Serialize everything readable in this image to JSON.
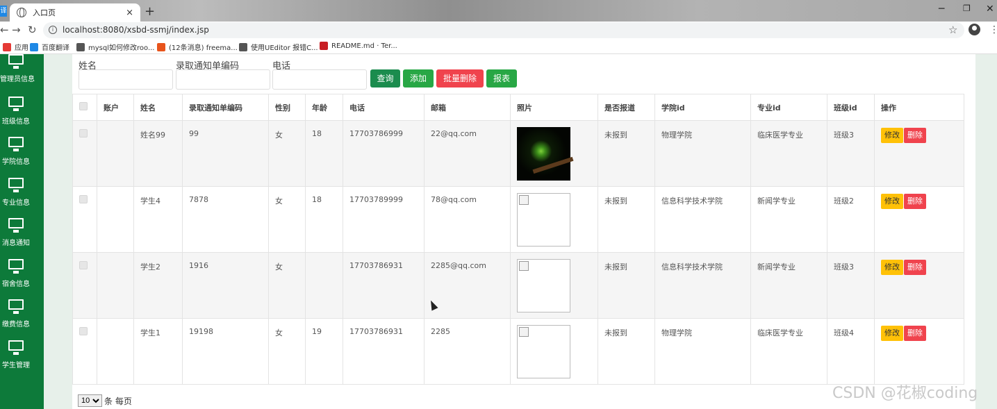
{
  "browser": {
    "tab_title": "入口页",
    "tab_close": "×",
    "new_tab": "+",
    "url": "localhost:8080/xsbd-ssmj/index.jsp",
    "bookmarks": [
      {
        "label": "应用",
        "icon": "apps-icon",
        "color": "#e53935"
      },
      {
        "label": "百度翻译",
        "icon": "baidu-translate-icon",
        "color": "#1e88e5"
      },
      {
        "label": "mysql如何修改roo...",
        "icon": "page-icon",
        "color": "#555555"
      },
      {
        "label": "(12条消息) freema...",
        "icon": "csdn-icon",
        "color": "#e8541c"
      },
      {
        "label": "使用UEditor 报错C...",
        "icon": "page-icon",
        "color": "#555555"
      },
      {
        "label": "README.md · Ter...",
        "icon": "gitee-icon",
        "color": "#c71d23"
      }
    ]
  },
  "sidebar": {
    "items": [
      {
        "label": "管理员信息"
      },
      {
        "label": "班级信息"
      },
      {
        "label": "学院信息"
      },
      {
        "label": "专业信息"
      },
      {
        "label": "消息通知"
      },
      {
        "label": "宿舍信息"
      },
      {
        "label": "缴费信息"
      },
      {
        "label": "学生管理"
      }
    ]
  },
  "filters": {
    "name_label": "姓名",
    "code_label": "录取通知单编码",
    "phone_label": "电话",
    "name_value": "",
    "code_value": "",
    "phone_value": ""
  },
  "buttons": {
    "search": "查询",
    "add": "添加",
    "batch_delete": "批量删除",
    "report": "报表"
  },
  "colors": {
    "sidebar": "#0d7a3a",
    "search_btn": "#1b8c4e",
    "add_btn": "#28a745",
    "batch_delete_btn": "#f0434d",
    "report_btn": "#28a745",
    "edit_btn": "#ffc107",
    "delete_btn": "#f0434d"
  },
  "table": {
    "headers": [
      "账户",
      "姓名",
      "录取通知单编码",
      "性别",
      "年龄",
      "电话",
      "邮箱",
      "照片",
      "是否报道",
      "学院id",
      "专业id",
      "班级id",
      "操作"
    ],
    "rows": [
      {
        "account": "",
        "name": "姓名99",
        "code": "99",
        "gender": "女",
        "age": "18",
        "phone": "17703786999",
        "email": "22@qq.com",
        "photo": "frog",
        "reported": "未报到",
        "college": "物理学院",
        "major": "临床医学专业",
        "class": "班级3"
      },
      {
        "account": "",
        "name": "学生4",
        "code": "7878",
        "gender": "女",
        "age": "18",
        "phone": "17703789999",
        "email": "78@qq.com",
        "photo": "broken",
        "reported": "未报到",
        "college": "信息科学技术学院",
        "major": "新闻学专业",
        "class": "班级2"
      },
      {
        "account": "",
        "name": "学生2",
        "code": "1916",
        "gender": "女",
        "age": "",
        "phone": "17703786931",
        "email": "2285@qq.com",
        "photo": "broken",
        "reported": "未报到",
        "college": "信息科学技术学院",
        "major": "新闻学专业",
        "class": "班级3"
      },
      {
        "account": "",
        "name": "学生1",
        "code": "19198",
        "gender": "女",
        "age": "19",
        "phone": "17703786931",
        "email": "2285",
        "photo": "broken",
        "reported": "未报到",
        "college": "物理学院",
        "major": "临床医学专业",
        "class": "班级4"
      }
    ],
    "edit_label": "修改",
    "delete_label": "删除"
  },
  "pager": {
    "page_size": "10",
    "suffix": "条 每页"
  },
  "watermark": "CSDN @花椒coding"
}
